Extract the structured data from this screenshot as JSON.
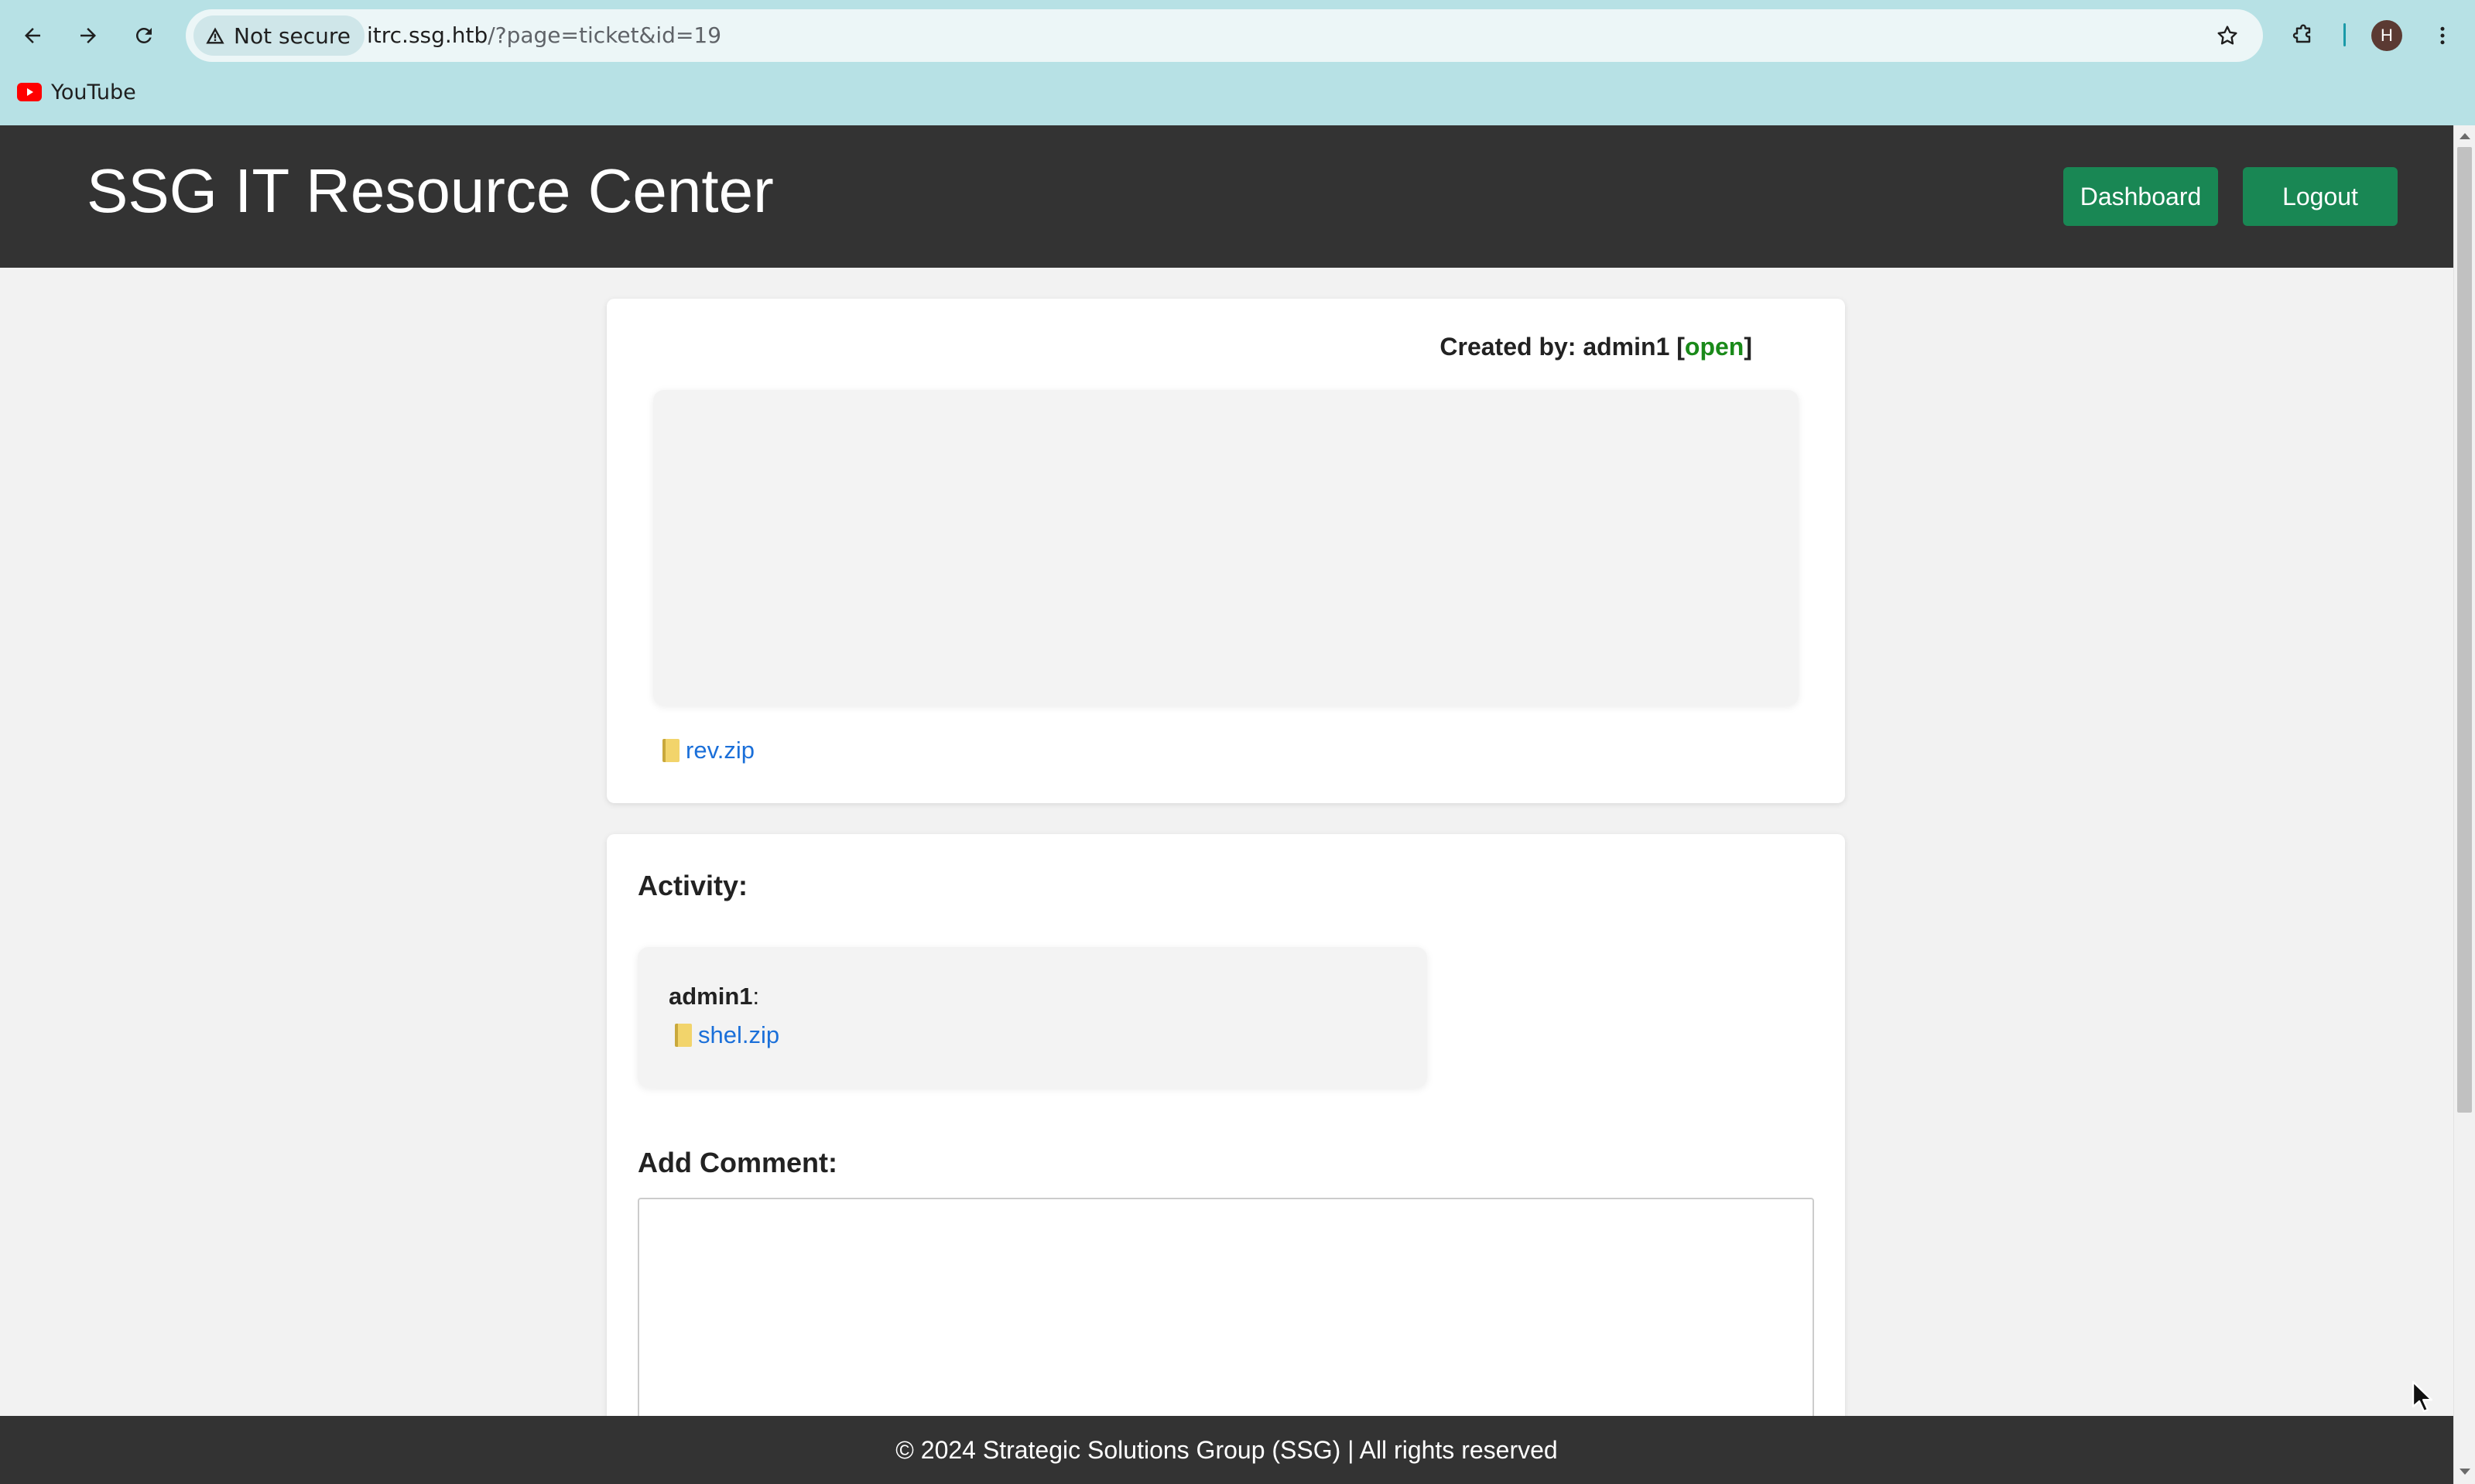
{
  "browser": {
    "security_label": "Not secure",
    "url_host": "itrc.ssg.htb",
    "url_path": "/?page=ticket&id=19",
    "profile_initial": "H",
    "bookmarks": [
      {
        "label": "YouTube",
        "icon": "youtube-icon"
      }
    ],
    "icons": [
      "back-icon",
      "forward-icon",
      "reload-icon",
      "warning-icon",
      "star-icon",
      "extensions-icon",
      "more-icon"
    ]
  },
  "site": {
    "title": "SSG IT Resource Center",
    "nav": {
      "dashboard_label": "Dashboard",
      "logout_label": "Logout"
    }
  },
  "ticket": {
    "created_by_prefix": "Created by: ",
    "created_by_user": "admin1",
    "status_open_bracket": " [",
    "status": "open",
    "status_close_bracket": "]",
    "status_color": "#1a8a1a",
    "attachment": "rev.zip"
  },
  "activity": {
    "heading": "Activity:",
    "comments": [
      {
        "author": "admin1",
        "separator": ":",
        "attachment": "shel.zip"
      }
    ]
  },
  "add_comment": {
    "heading": "Add Comment:",
    "value": ""
  },
  "footer": {
    "text": "© 2024 Strategic Solutions Group (SSG) | All rights reserved"
  },
  "colors": {
    "chrome_bg": "#b7e1e5",
    "header_bg": "#333333",
    "button_green": "#198754",
    "link_blue": "#1a6fd9",
    "page_bg": "#f2f2f2"
  }
}
